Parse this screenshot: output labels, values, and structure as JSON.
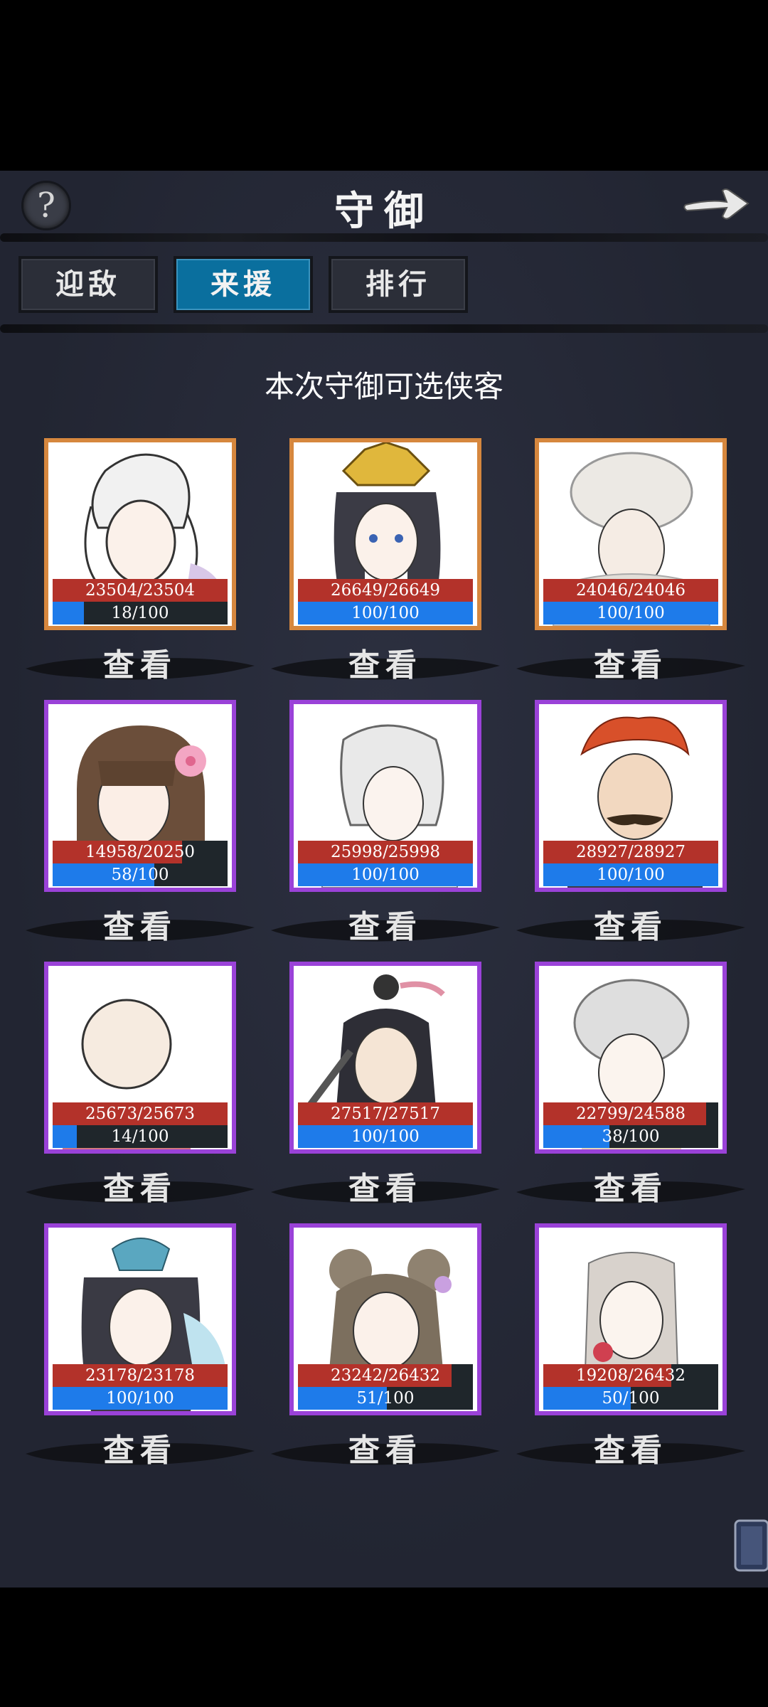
{
  "header": {
    "title": "守御",
    "help_icon": "question-icon",
    "next_icon": "arrow-right-icon"
  },
  "tabs": [
    {
      "label": "迎敌",
      "active": false
    },
    {
      "label": "来援",
      "active": true
    },
    {
      "label": "排行",
      "active": false
    }
  ],
  "subtitle": "本次守御可选侠客",
  "view_label": "查看",
  "colors": {
    "orange_frame": "#d6873e",
    "purple_frame": "#9a42d8",
    "hp": "#b3322a",
    "mp": "#1e7bea",
    "active_tab": "#0a6f9e"
  },
  "heroes": [
    {
      "hp_text": "23504/23504",
      "hp_ratio": 1.0,
      "mp_text": "18/100",
      "mp_ratio": 0.18,
      "frame": "orange",
      "portrait": "swordsman-white-hair"
    },
    {
      "hp_text": "26649/26649",
      "hp_ratio": 1.0,
      "mp_text": "100/100",
      "mp_ratio": 1.0,
      "frame": "orange",
      "portrait": "princess-golden-crown"
    },
    {
      "hp_text": "24046/24046",
      "hp_ratio": 1.0,
      "mp_text": "100/100",
      "mp_ratio": 1.0,
      "frame": "orange",
      "portrait": "man-fur-hat"
    },
    {
      "hp_text": "14958/20250",
      "hp_ratio": 0.74,
      "mp_text": "58/100",
      "mp_ratio": 0.58,
      "frame": "purple",
      "portrait": "girl-flower-hair"
    },
    {
      "hp_text": "25998/25998",
      "hp_ratio": 1.0,
      "mp_text": "100/100",
      "mp_ratio": 1.0,
      "frame": "purple",
      "portrait": "young-man-ponytail"
    },
    {
      "hp_text": "28927/28927",
      "hp_ratio": 1.0,
      "mp_text": "100/100",
      "mp_ratio": 1.0,
      "frame": "purple",
      "portrait": "man-red-hair-mustache"
    },
    {
      "hp_text": "25673/25673",
      "hp_ratio": 1.0,
      "mp_text": "14/100",
      "mp_ratio": 0.14,
      "frame": "purple",
      "portrait": "bald-monk"
    },
    {
      "hp_text": "27517/27517",
      "hp_ratio": 1.0,
      "mp_text": "100/100",
      "mp_ratio": 1.0,
      "frame": "purple",
      "portrait": "warrior-topknot"
    },
    {
      "hp_text": "22799/24588",
      "hp_ratio": 0.93,
      "mp_text": "38/100",
      "mp_ratio": 0.38,
      "frame": "purple",
      "portrait": "boy-grey-cap"
    },
    {
      "hp_text": "23178/23178",
      "hp_ratio": 1.0,
      "mp_text": "100/100",
      "mp_ratio": 1.0,
      "frame": "purple",
      "portrait": "lady-ornate-headdress"
    },
    {
      "hp_text": "23242/26432",
      "hp_ratio": 0.88,
      "mp_text": "51/100",
      "mp_ratio": 0.51,
      "frame": "purple",
      "portrait": "girl-hair-buns"
    },
    {
      "hp_text": "19208/26432",
      "hp_ratio": 0.73,
      "mp_text": "50/100",
      "mp_ratio": 0.5,
      "frame": "purple",
      "portrait": "woman-braids"
    }
  ]
}
